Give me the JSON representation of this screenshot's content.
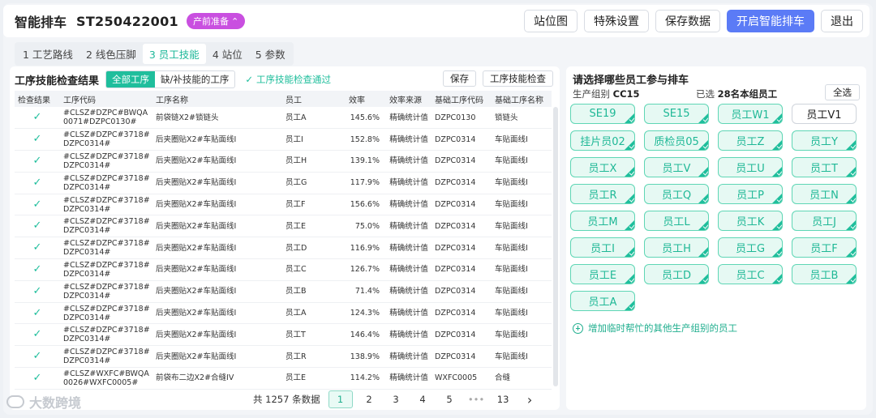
{
  "header": {
    "title": "智能排车",
    "order_no": "ST250422001",
    "stage": "产前准备",
    "buttons": [
      "站位图",
      "特殊设置",
      "保存数据",
      "开启智能排车",
      "退出"
    ]
  },
  "tabs": [
    "1 工艺路线",
    "2 线色压脚",
    "3 员工技能",
    "4 站位",
    "5 参数"
  ],
  "left": {
    "title": "工序技能检查结果",
    "filters": [
      "全部工序",
      "缺/补技能的工序"
    ],
    "pass_text": "工序技能检查通过",
    "save_label": "保存",
    "check_label": "工序技能检查",
    "columns": [
      "检查结果",
      "工序代码",
      "工序名称",
      "员工",
      "效率",
      "效率来源",
      "基础工序代码",
      "基础工序名称"
    ],
    "rows": [
      {
        "code": "#CLSZ#DZPC#BWQA0071#DZPC0130#",
        "name": "前袋链X2#锁链头",
        "emp": "员工A",
        "rate": "145.6%",
        "src": "精确统计值",
        "bcode": "DZPC0130",
        "bname": "锁链头"
      },
      {
        "code": "#CLSZ#DZPC#3718#DZPC0314#",
        "name": "后夹圈贴X2#车贴面线I",
        "emp": "员工I",
        "rate": "152.8%",
        "src": "精确统计值",
        "bcode": "DZPC0314",
        "bname": "车贴面线I"
      },
      {
        "code": "#CLSZ#DZPC#3718#DZPC0314#",
        "name": "后夹圈贴X2#车贴面线I",
        "emp": "员工H",
        "rate": "139.1%",
        "src": "精确统计值",
        "bcode": "DZPC0314",
        "bname": "车贴面线I"
      },
      {
        "code": "#CLSZ#DZPC#3718#DZPC0314#",
        "name": "后夹圈贴X2#车贴面线I",
        "emp": "员工G",
        "rate": "117.9%",
        "src": "精确统计值",
        "bcode": "DZPC0314",
        "bname": "车贴面线I"
      },
      {
        "code": "#CLSZ#DZPC#3718#DZPC0314#",
        "name": "后夹圈贴X2#车贴面线I",
        "emp": "员工F",
        "rate": "156.6%",
        "src": "精确统计值",
        "bcode": "DZPC0314",
        "bname": "车贴面线I"
      },
      {
        "code": "#CLSZ#DZPC#3718#DZPC0314#",
        "name": "后夹圈贴X2#车贴面线I",
        "emp": "员工E",
        "rate": "75.0%",
        "src": "精确统计值",
        "bcode": "DZPC0314",
        "bname": "车贴面线I"
      },
      {
        "code": "#CLSZ#DZPC#3718#DZPC0314#",
        "name": "后夹圈贴X2#车贴面线I",
        "emp": "员工D",
        "rate": "116.9%",
        "src": "精确统计值",
        "bcode": "DZPC0314",
        "bname": "车贴面线I"
      },
      {
        "code": "#CLSZ#DZPC#3718#DZPC0314#",
        "name": "后夹圈贴X2#车贴面线I",
        "emp": "员工C",
        "rate": "126.7%",
        "src": "精确统计值",
        "bcode": "DZPC0314",
        "bname": "车贴面线I"
      },
      {
        "code": "#CLSZ#DZPC#3718#DZPC0314#",
        "name": "后夹圈贴X2#车贴面线I",
        "emp": "员工B",
        "rate": "71.4%",
        "src": "精确统计值",
        "bcode": "DZPC0314",
        "bname": "车贴面线I"
      },
      {
        "code": "#CLSZ#DZPC#3718#DZPC0314#",
        "name": "后夹圈贴X2#车贴面线I",
        "emp": "员工A",
        "rate": "124.3%",
        "src": "精确统计值",
        "bcode": "DZPC0314",
        "bname": "车贴面线I"
      },
      {
        "code": "#CLSZ#DZPC#3718#DZPC0314#",
        "name": "后夹圈贴X2#车贴面线I",
        "emp": "员工T",
        "rate": "146.4%",
        "src": "精确统计值",
        "bcode": "DZPC0314",
        "bname": "车贴面线I"
      },
      {
        "code": "#CLSZ#DZPC#3718#DZPC0314#",
        "name": "后夹圈贴X2#车贴面线I",
        "emp": "员工R",
        "rate": "138.9%",
        "src": "精确统计值",
        "bcode": "DZPC0314",
        "bname": "车贴面线I"
      },
      {
        "code": "#CLSZ#WXFC#BWQA0026#WXFC0005#",
        "name": "前袋布二边X2#合缝IV",
        "emp": "员工E",
        "rate": "114.2%",
        "src": "精确统计值",
        "bcode": "WXFC0005",
        "bname": "合缝"
      }
    ],
    "pager": {
      "total": "共 1257 条数据",
      "pages": [
        "1",
        "2",
        "3",
        "4",
        "5",
        "•••",
        "13"
      ],
      "next": "›"
    }
  },
  "right": {
    "title": "请选择哪些员工参与排车",
    "group_label": "生产组别",
    "group_value": "CC15",
    "selected_label": "已选",
    "selected_value": "28名本组员工",
    "select_all": "全选",
    "chips": [
      {
        "label": "SE19",
        "on": true
      },
      {
        "label": "SE15",
        "on": true
      },
      {
        "label": "员工W1",
        "on": true
      },
      {
        "label": "员工V1",
        "on": false
      },
      {
        "label": "挂片员02",
        "on": true
      },
      {
        "label": "质检员05",
        "on": true
      },
      {
        "label": "员工Z",
        "on": true
      },
      {
        "label": "员工Y",
        "on": true
      },
      {
        "label": "员工X",
        "on": true
      },
      {
        "label": "员工V",
        "on": true
      },
      {
        "label": "员工U",
        "on": true
      },
      {
        "label": "员工T",
        "on": true
      },
      {
        "label": "员工R",
        "on": true
      },
      {
        "label": "员工Q",
        "on": true
      },
      {
        "label": "员工P",
        "on": true
      },
      {
        "label": "员工N",
        "on": true
      },
      {
        "label": "员工M",
        "on": true
      },
      {
        "label": "员工L",
        "on": true
      },
      {
        "label": "员工K",
        "on": true
      },
      {
        "label": "员工J",
        "on": true
      },
      {
        "label": "员工I",
        "on": true
      },
      {
        "label": "员工H",
        "on": true
      },
      {
        "label": "员工G",
        "on": true
      },
      {
        "label": "员工F",
        "on": true
      },
      {
        "label": "员工E",
        "on": true
      },
      {
        "label": "员工D",
        "on": true
      },
      {
        "label": "员工C",
        "on": true
      },
      {
        "label": "员工B",
        "on": true
      },
      {
        "label": "员工A",
        "on": true
      }
    ],
    "add_temp": "增加临时帮忙的其他生产组别的员工"
  },
  "watermark": "大数跨境",
  "colors": {
    "accent": "#1fbe9c",
    "primary": "#5b7bf6",
    "stage": "#c94fe0"
  }
}
